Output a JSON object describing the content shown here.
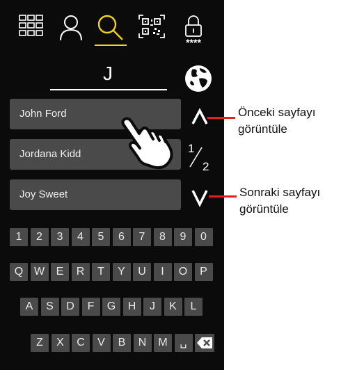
{
  "nav": {
    "tabs": [
      {
        "icon": "grid-menu-icon"
      },
      {
        "icon": "person-icon"
      },
      {
        "icon": "search-icon",
        "active": true
      },
      {
        "icon": "qr-code-icon"
      },
      {
        "icon": "lock-pin-icon",
        "label": "****"
      }
    ],
    "active_color": "#f2d21c"
  },
  "search": {
    "query": "J"
  },
  "results": [
    "John Ford",
    "Jordana Kidd",
    "Joy Sweet"
  ],
  "pager": {
    "current": "1",
    "total": "2"
  },
  "keyboard": {
    "rows": [
      [
        "1",
        "2",
        "3",
        "4",
        "5",
        "6",
        "7",
        "8",
        "9",
        "0"
      ],
      [
        "Q",
        "W",
        "E",
        "R",
        "T",
        "Y",
        "U",
        "I",
        "O",
        "P"
      ],
      [
        "A",
        "S",
        "D",
        "F",
        "G",
        "H",
        "J",
        "K",
        "L"
      ],
      [
        "Z",
        "X",
        "C",
        "V",
        "B",
        "N",
        "M",
        "␣"
      ]
    ]
  },
  "annotations": {
    "previous_page": [
      "Önceki sayfayı",
      "görüntüle"
    ],
    "next_page": [
      "Sonraki sayfayı",
      "görüntüle"
    ]
  },
  "colors": {
    "background": "#0b0b0b",
    "key": "#4a4a4a",
    "callout": "#e2231a"
  }
}
